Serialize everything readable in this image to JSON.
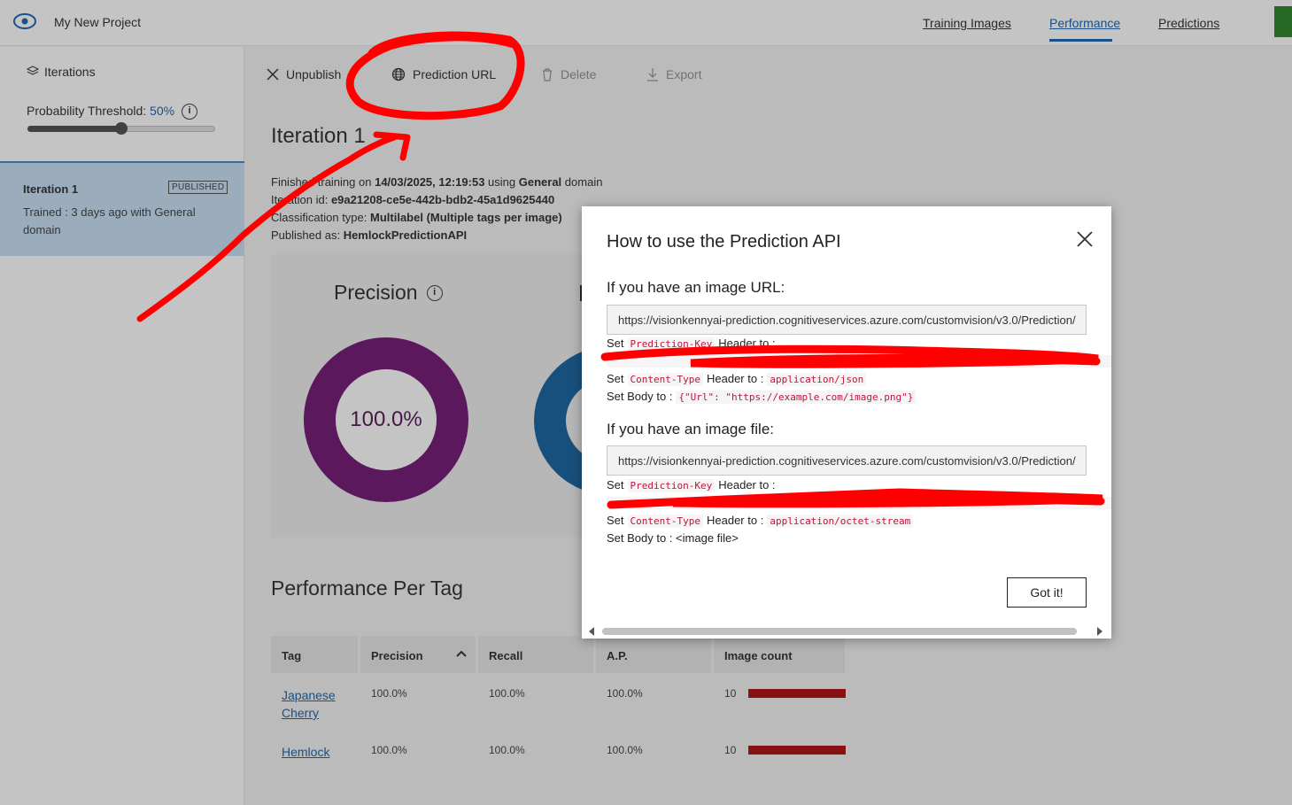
{
  "header": {
    "project_name": "My New Project",
    "nav": [
      "Training Images",
      "Performance",
      "Predictions"
    ],
    "active_tab": "Performance"
  },
  "sidebar": {
    "iterations_label": "Iterations",
    "threshold_label": "Probability Threshold:",
    "threshold_value": "50%",
    "threshold_fraction": 0.5,
    "iteration": {
      "name": "Iteration 1",
      "badge": "PUBLISHED",
      "trained": "Trained : 3 days ago with General domain"
    }
  },
  "toolbar": {
    "unpublish": "Unpublish",
    "prediction_url": "Prediction URL",
    "delete": "Delete",
    "export": "Export"
  },
  "iteration_detail": {
    "title": "Iteration 1",
    "finished_prefix": "Finished training on",
    "finished_date": "14/03/2025, 12:19:53",
    "using": "using",
    "domain": "General",
    "domain_suffix": "domain",
    "id_label": "Iteration id:",
    "id_value": "e9a21208-ce5e-442b-bdb2-45a1d9625440",
    "class_label": "Classification type:",
    "class_value": "Multilabel (Multiple tags per image)",
    "published_label": "Published as:",
    "published_value": "HemlockPredictionAPI"
  },
  "metrics": {
    "precision_label": "Precision",
    "precision_value": "100.0%"
  },
  "perf_table": {
    "title": "Performance Per Tag",
    "columns": [
      "Tag",
      "Precision",
      "Recall",
      "A.P.",
      "Image count"
    ],
    "rows": [
      {
        "tag": "Japanese Cherry",
        "precision": "100.0%",
        "recall": "100.0%",
        "ap": "100.0%",
        "count": "10"
      },
      {
        "tag": "Hemlock",
        "precision": "100.0%",
        "recall": "100.0%",
        "ap": "100.0%",
        "count": "10"
      }
    ]
  },
  "modal": {
    "title": "How to use the Prediction API",
    "url_section": "If you have an image URL:",
    "url_value": "https://visionkennyai-prediction.cognitiveservices.azure.com/customvision/v3.0/Prediction/",
    "file_section": "If you have an image file:",
    "file_value": "https://visionkennyai-prediction.cognitiveservices.azure.com/customvision/v3.0/Prediction/",
    "set": "Set",
    "header_to": "Header to :",
    "prediction_key": "Prediction-Key",
    "content_type": "Content-Type",
    "json_type": "application/json",
    "body_to": "Set Body to :",
    "body_json": "{\"Url\": \"https://example.com/image.png\"}",
    "octet_type": "application/octet-stream",
    "body_file": "Set Body to : <image file>",
    "got_it": "Got it!"
  },
  "colors": {
    "accent": "#0a5aa8",
    "precision_donut": "#6b0a6b",
    "recall_donut": "#0a5a9a",
    "annotation": "#ff0000",
    "count_bar": "#a80000"
  }
}
